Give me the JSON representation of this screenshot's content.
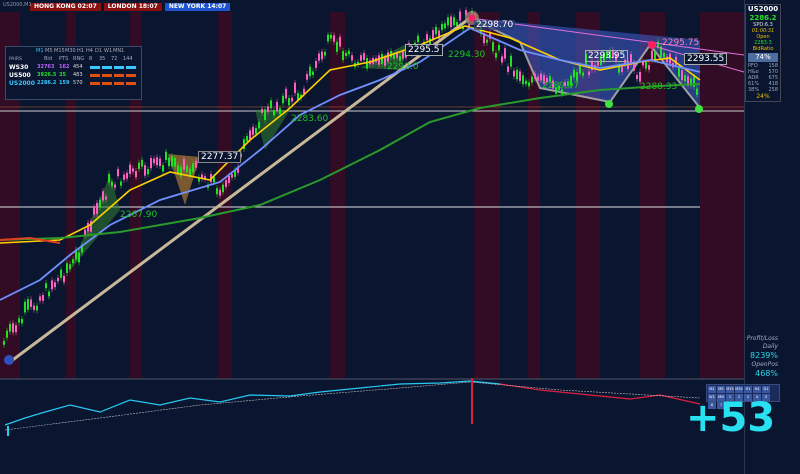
{
  "sessions": {
    "hong_kong": "HONG KONG 02:07",
    "london": "LONDON  18:07",
    "new_york": "NEW YORK  14:07"
  },
  "chart_symbol_label": "US2000,M1",
  "info_panel": {
    "symbol": "US2000",
    "price": "2286.2",
    "spread": "SPD:6.3",
    "countdown": "01:00:31",
    "open_label": "Open",
    "open_value": "2283.3",
    "ratio_label": "BidRatio",
    "ratio_pct": "74%",
    "rows": [
      {
        "label": "PFO",
        "value": "158"
      },
      {
        "label": "H&o",
        "value": "570"
      },
      {
        "label": "ADR",
        "value": "675"
      },
      {
        "label": "61%",
        "value": "418"
      },
      {
        "label": "38%",
        "value": "258"
      }
    ],
    "bottom_pct": "24%"
  },
  "watch_table": {
    "header": [
      "M1",
      "M5",
      "M15",
      "M30",
      "H1",
      "H4",
      "D1",
      "W1",
      "MN1"
    ],
    "sub_header": [
      "PAIRS",
      "Bid",
      "PTS",
      "RNG",
      "8",
      "35",
      "72",
      "144"
    ],
    "rows": [
      {
        "symbol": "WS30",
        "bid": "32763",
        "pts": "162",
        "rng": "454",
        "color": "#c060ff"
      },
      {
        "symbol": "US500",
        "bid": "3926.5",
        "pts": "35",
        "rng": "483",
        "color": "#22e022"
      },
      {
        "symbol": "US2000",
        "bid": "2286.2",
        "pts": "159",
        "rng": "570",
        "color": "#38c8ff"
      }
    ]
  },
  "price_tags": [
    {
      "id": "t1",
      "text": "2298.70"
    },
    {
      "id": "t2",
      "text": "2295.75"
    },
    {
      "id": "t3",
      "text": "2295.5"
    },
    {
      "id": "t4",
      "text": "2294.30"
    },
    {
      "id": "t5",
      "text": "2293.95"
    },
    {
      "id": "t6",
      "text": "2293.55"
    },
    {
      "id": "t7",
      "text": "2292.0"
    },
    {
      "id": "t8",
      "text": "2289.07"
    },
    {
      "id": "t9",
      "text": "2288.33"
    },
    {
      "id": "t10",
      "text": "2283.60"
    },
    {
      "id": "t11",
      "text": "2277.37"
    },
    {
      "id": "t12",
      "text": "2267.90"
    }
  ],
  "profit_loss": {
    "label": "Profit/Loss",
    "period": "Daily",
    "value": "8239%",
    "open_label": "OpenPos",
    "open_value": "468%"
  },
  "points_display": "+53",
  "timeframes": [
    "M1",
    "M5",
    "M15",
    "M30",
    "H1",
    "H4",
    "D1",
    "W1",
    "MN",
    "1",
    "2",
    "3",
    "4",
    "5",
    "6",
    "7"
  ],
  "colors": {
    "background": "#0a1530",
    "session_band": "#3a0a22",
    "bull_candle": "#22e022",
    "bear_candle": "#ff60c0",
    "ma_fast": "#ffd000",
    "ma_mid": "#7090ff",
    "ma_slow": "#2a9a2a",
    "trend_line": "#c8b898",
    "osc_line": "#28c8f0",
    "osc_neg": "#e02040"
  }
}
